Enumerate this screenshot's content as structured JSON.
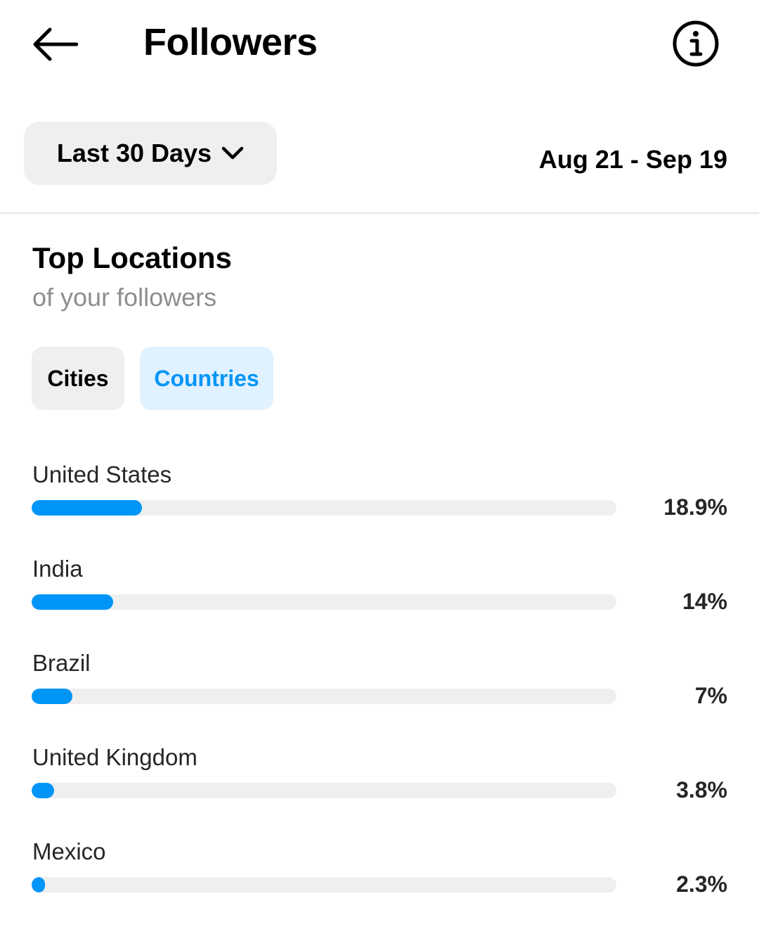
{
  "header": {
    "title": "Followers",
    "back_icon": "arrow-left-icon",
    "info_icon": "info-circle-icon"
  },
  "filter": {
    "range_label": "Last 30 Days",
    "dropdown_icon": "chevron-down-icon",
    "date_range": "Aug 21 - Sep 19"
  },
  "section": {
    "title": "Top Locations",
    "subtitle": "of your followers"
  },
  "tabs": [
    {
      "label": "Cities",
      "selected": false
    },
    {
      "label": "Countries",
      "selected": true
    }
  ],
  "colors": {
    "accent": "#0095f6",
    "selected_tab_bg": "#e0f1ff",
    "track": "#efefef"
  },
  "locations": [
    {
      "name": "United States",
      "value_label": "18.9%",
      "percent": 18.9
    },
    {
      "name": "India",
      "value_label": "14%",
      "percent": 14
    },
    {
      "name": "Brazil",
      "value_label": "7%",
      "percent": 7
    },
    {
      "name": "United Kingdom",
      "value_label": "3.8%",
      "percent": 3.8
    },
    {
      "name": "Mexico",
      "value_label": "2.3%",
      "percent": 2.3
    }
  ]
}
